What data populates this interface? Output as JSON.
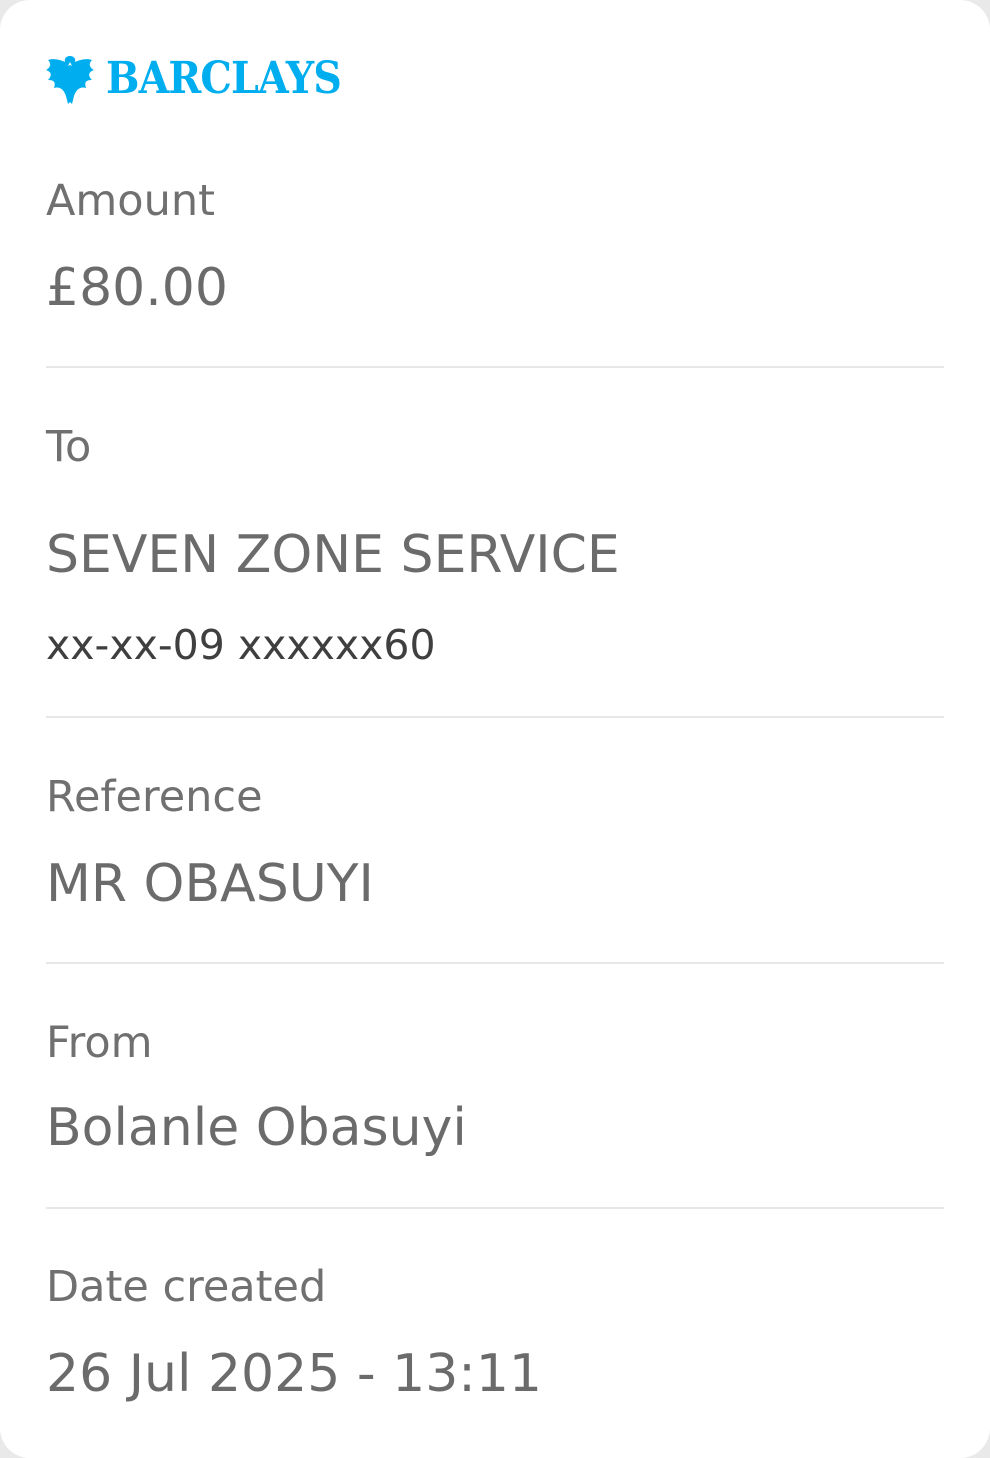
{
  "brand": {
    "name": "BARCLAYS",
    "color": "#00aeef",
    "icon": "eagle-icon"
  },
  "amount": {
    "label": "Amount",
    "value": "£80.00"
  },
  "to": {
    "label": "To",
    "payee": "SEVEN ZONE SERVICE",
    "account": "xx-xx-09 xxxxxx60"
  },
  "reference": {
    "label": "Reference",
    "value": "MR OBASUYI"
  },
  "from": {
    "label": "From",
    "value": "Bolanle Obasuyi"
  },
  "date_created": {
    "label": "Date created",
    "value": "26 Jul 2025 - 13:11"
  }
}
